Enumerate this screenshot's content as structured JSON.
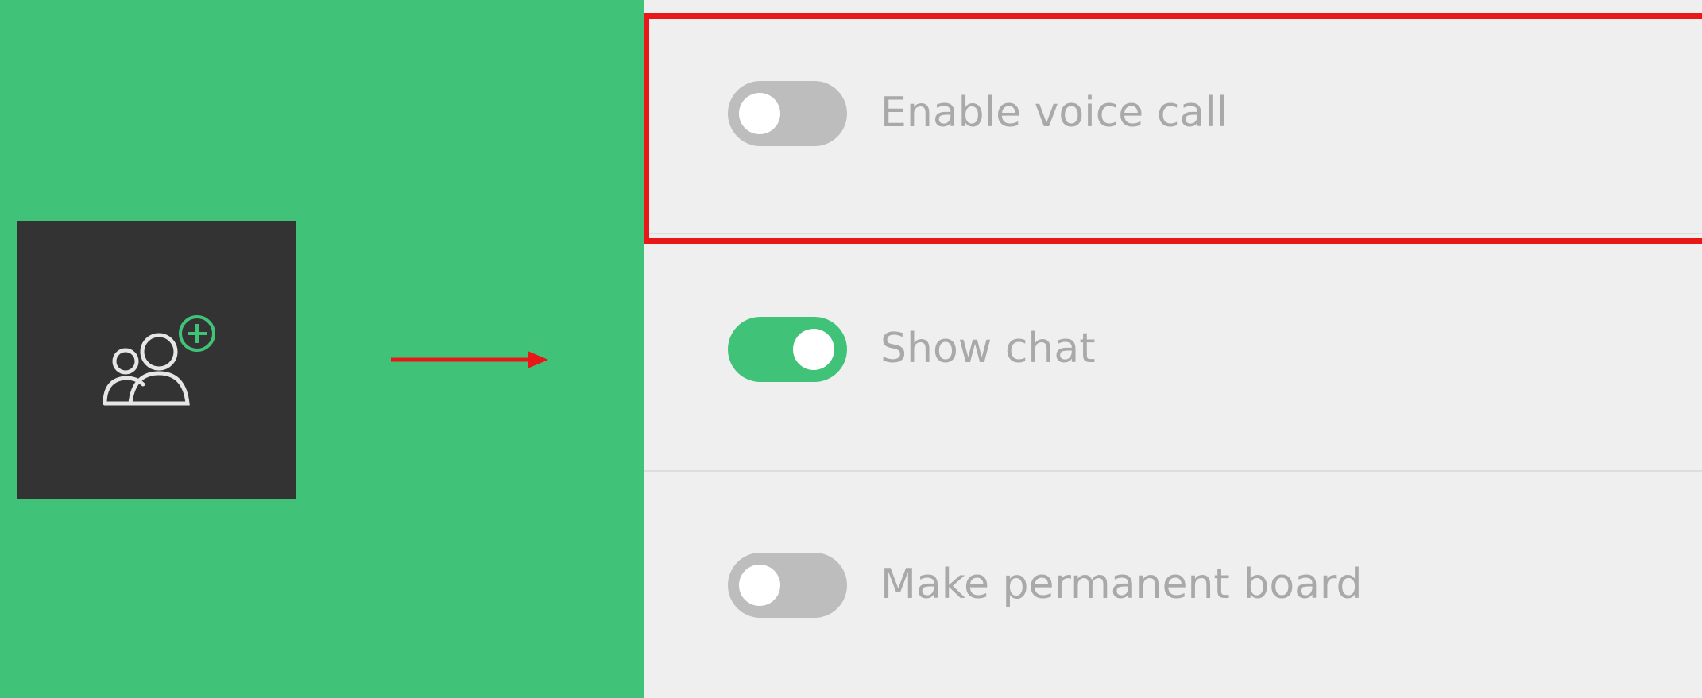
{
  "settings": {
    "items": [
      {
        "label": "Enable voice call",
        "enabled": false
      },
      {
        "label": "Show chat",
        "enabled": true
      },
      {
        "label": "Make permanent board",
        "enabled": false
      }
    ]
  },
  "colors": {
    "accent": "#40c379",
    "tile": "#333333",
    "panel": "#efefef",
    "toggle_off": "#bdbdbd",
    "label_text": "#a9a9a9",
    "highlight": "#e81818"
  },
  "icons": {
    "invite_tile": "invite-people-icon",
    "pointer": "red-arrow-icon"
  }
}
